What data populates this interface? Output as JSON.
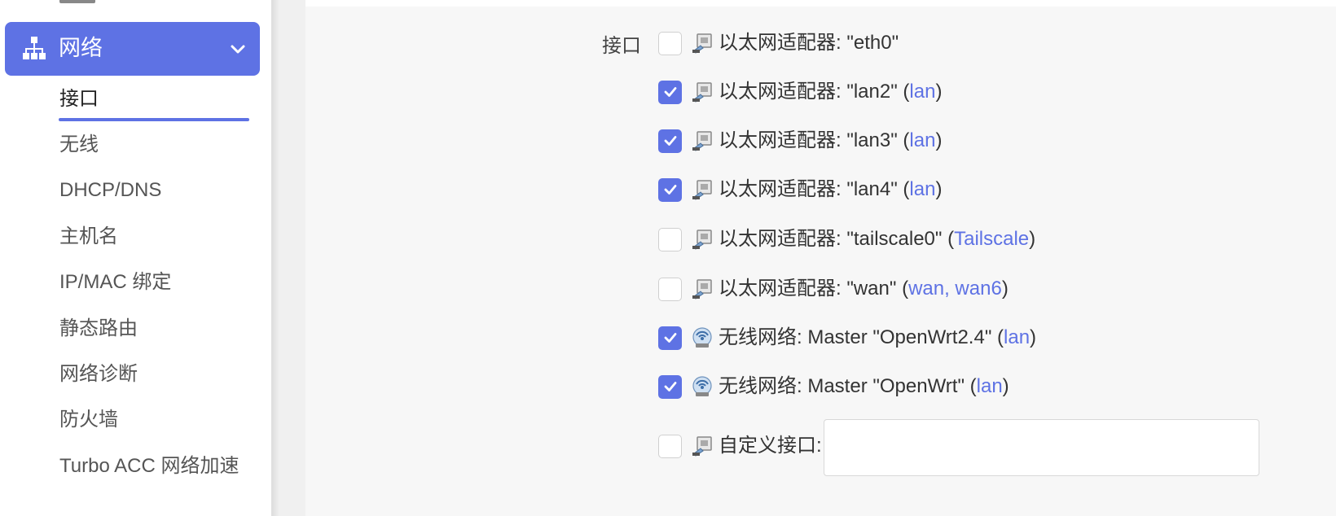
{
  "sidebar": {
    "group_title": "网络",
    "items": [
      {
        "label": "接口",
        "active": true
      },
      {
        "label": "无线"
      },
      {
        "label": "DHCP/DNS"
      },
      {
        "label": "主机名"
      },
      {
        "label": "IP/MAC 绑定"
      },
      {
        "label": "静态路由"
      },
      {
        "label": "网络诊断"
      },
      {
        "label": "防火墙"
      },
      {
        "label": "Turbo ACC 网络加速"
      }
    ]
  },
  "form": {
    "field_label": "接口",
    "interfaces": [
      {
        "prefix": "以太网适配器: \"eth0\"",
        "checked": false,
        "type": "ethernet"
      },
      {
        "prefix": "以太网适配器: \"lan2\" (",
        "networks": "lan",
        "suffix": ")",
        "checked": true,
        "type": "ethernet"
      },
      {
        "prefix": "以太网适配器: \"lan3\" (",
        "networks": "lan",
        "suffix": ")",
        "checked": true,
        "type": "ethernet"
      },
      {
        "prefix": "以太网适配器: \"lan4\" (",
        "networks": "lan",
        "suffix": ")",
        "checked": true,
        "type": "ethernet"
      },
      {
        "prefix": "以太网适配器: \"tailscale0\" (",
        "networks": "Tailscale",
        "suffix": ")",
        "checked": false,
        "type": "ethernet"
      },
      {
        "prefix": "以太网适配器: \"wan\" (",
        "networks": "wan, wan6",
        "suffix": ")",
        "checked": false,
        "type": "ethernet"
      },
      {
        "prefix": "无线网络: Master \"OpenWrt2.4\" (",
        "networks": "lan",
        "suffix": ")",
        "checked": true,
        "type": "wireless"
      },
      {
        "prefix": "无线网络: Master \"OpenWrt\" (",
        "networks": "lan",
        "suffix": ")",
        "checked": true,
        "type": "wireless"
      }
    ],
    "custom": {
      "label": "自定义接口:",
      "value": "",
      "checked": false
    }
  },
  "colors": {
    "accent": "#5e72e4"
  }
}
